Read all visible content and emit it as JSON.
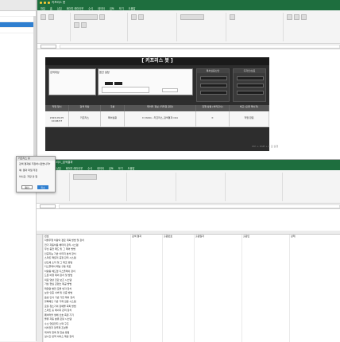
{
  "window1": {
    "title": "키프리스 봇",
    "menu": [
      "파일",
      "홈",
      "삽입",
      "페이지 레이아웃",
      "수식",
      "데이터",
      "검토",
      "보기",
      "도움말"
    ],
    "form_title": "[ 키프리스 봇 ]",
    "sections": {
      "search_label": "검색대상",
      "options_label": "옵션 설정",
      "save_path_label": "저장 경로",
      "result_label": "저장할 경로",
      "right_box1": "특허실용신안",
      "right_box2": "디자인/상표"
    },
    "buttons": {
      "run": "키프리스 실행",
      "stop": "중지",
      "save": "결과 저장"
    },
    "table": {
      "headers": [
        "작업 일시",
        "검색 대상",
        "구분",
        "데이터 정보\n(저작권 관련)",
        "진행 상황\n(처리건수)",
        "비고\n(오류 메시지)"
      ],
      "rows": [
        [
          "2024-09-05 10:46:57",
          "키프리스",
          "특허실용",
          "C:\\data\\...키프리스_검색결과.xlsx",
          "0",
          "작업 완료"
        ]
      ]
    },
    "footnote": "Ctrl + Shift + E 로 실행"
  },
  "popup": {
    "title": "키프리스 봇",
    "message": "검색 결과를 저장하시겠습니까?",
    "option1": "예: 결과 파일 저장",
    "option2": "아니요: 저장 안 함",
    "ok": "확인",
    "cancel": "취소"
  },
  "window2": {
    "title": "키프리스_검색결과",
    "headers": [
      "번호",
      "검색 결과",
      "출원번호",
      "출원일자",
      "출원인",
      "상태"
    ],
    "rows": [
      "자율주행 차량의 경로 계획 방법 및 장치",
      "전기 자동차용 배터리 관리 시스템",
      "무선 충전 패드 및 그 제어 방법",
      "인공지능 기반 이미지 분석 장치",
      "스마트 팩토리 공정 관리 시스템",
      "반도체 소자 및 그 제조 방법",
      "디스플레이 패널 구동 회로",
      "차량용 헤드업 디스플레이 장치",
      "드론 비행 제어 장치 및 방법",
      "의료 영상 진단 보조 시스템",
      "가상 현실 콘텐츠 제공 방법",
      "태양광 발전 모듈 냉각 장치",
      "보안 인증 서버 및 인증 방법",
      "음성 인식 기반 가전 제어 장치",
      "블록체인 기반 거래 검증 시스템",
      "로봇 청소기의 장애물 회피 방법",
      "스마트 홈 에너지 관리 장치",
      "웨어러블 생체 신호 측정 기기",
      "물류 자동 분류 로봇 시스템",
      "수소 연료전지 스택 구조",
      "이차전지 양극재 조성물",
      "데이터 압축 및 전송 방법",
      "실시간 번역 서비스 제공 장치"
    ]
  }
}
